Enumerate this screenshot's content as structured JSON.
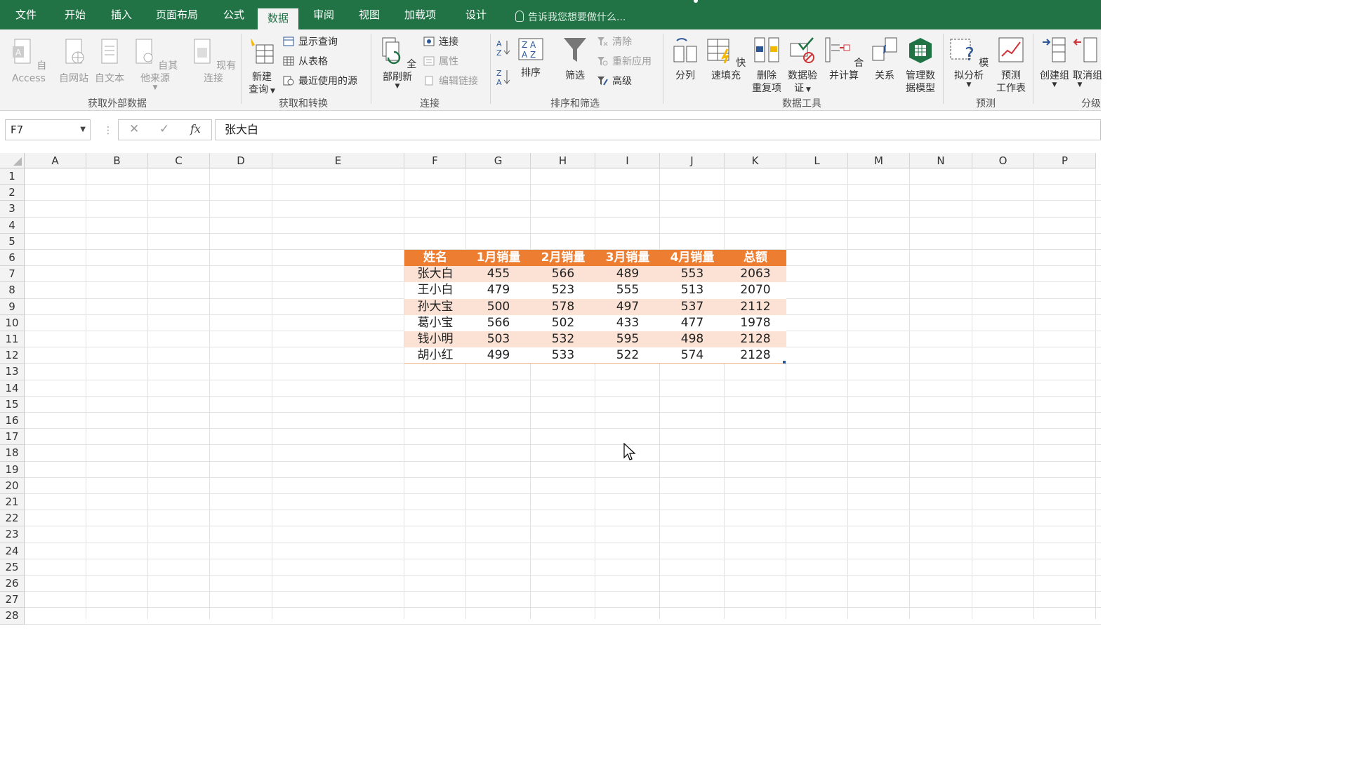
{
  "tabs": [
    "文件",
    "开始",
    "插入",
    "页面布局",
    "公式",
    "数据",
    "审阅",
    "视图",
    "加载项",
    "设计"
  ],
  "active_tab": "数据",
  "tell_me": "告诉我您想要做什么...",
  "ribbon": {
    "get_external": {
      "access": "自 Access",
      "web": "自网站",
      "text": "自文本",
      "other": "自其他来源",
      "existing": "现有连接",
      "label": "获取外部数据"
    },
    "transform": {
      "new_query_1": "新建",
      "new_query_2": "查询",
      "show_queries": "显示查询",
      "from_table": "从表格",
      "recent_sources": "最近使用的源",
      "label": "获取和转换"
    },
    "connections": {
      "refresh_all": "全部刷新",
      "connections": "连接",
      "properties": "属性",
      "edit_links": "编辑链接",
      "label": "连接"
    },
    "sort_filter": {
      "sort": "排序",
      "filter": "筛选",
      "clear": "清除",
      "reapply": "重新应用",
      "advanced": "高级",
      "label": "排序和筛选"
    },
    "data_tools": {
      "text_to_columns": "分列",
      "flash_fill": "快速填充",
      "remove_dup_1": "删除",
      "remove_dup_2": "重复项",
      "validation_1": "数据验",
      "validation_2": "证",
      "consolidate": "合并计算",
      "relationships": "关系",
      "data_model_1": "管理数",
      "data_model_2": "据模型",
      "label": "数据工具"
    },
    "forecast": {
      "what_if": "模拟分析",
      "forecast_1": "预测",
      "forecast_2": "工作表",
      "label": "预测"
    },
    "outline": {
      "group": "创建组",
      "ungroup": "取消组",
      "label": "分级"
    }
  },
  "formula_bar": {
    "name_box": "F7",
    "formula": "张大白",
    "fx": "fx"
  },
  "columns": [
    "A",
    "B",
    "C",
    "D",
    "E",
    "F",
    "G",
    "H",
    "I",
    "J",
    "K",
    "L",
    "M",
    "N",
    "O",
    "P"
  ],
  "rows": [
    "1",
    "2",
    "3",
    "4",
    "5",
    "6",
    "7",
    "8",
    "9",
    "10",
    "11",
    "12",
    "13",
    "14",
    "15",
    "16",
    "17",
    "18",
    "19",
    "20",
    "21",
    "22",
    "23",
    "24",
    "25",
    "26",
    "27",
    "28"
  ],
  "table": {
    "headers": [
      "姓名",
      "1月销量",
      "2月销量",
      "3月销量",
      "4月销量",
      "总额"
    ],
    "rows": [
      [
        "张大白",
        "455",
        "566",
        "489",
        "553",
        "2063"
      ],
      [
        "王小白",
        "479",
        "523",
        "555",
        "513",
        "2070"
      ],
      [
        "孙大宝",
        "500",
        "578",
        "497",
        "537",
        "2112"
      ],
      [
        "葛小宝",
        "566",
        "502",
        "433",
        "477",
        "1978"
      ],
      [
        "钱小明",
        "503",
        "532",
        "595",
        "498",
        "2128"
      ],
      [
        "胡小红",
        "499",
        "533",
        "522",
        "574",
        "2128"
      ]
    ],
    "colors": {
      "header": "#ed7d31",
      "band": "#fbe2d5",
      "plain": "#ffffff"
    }
  }
}
